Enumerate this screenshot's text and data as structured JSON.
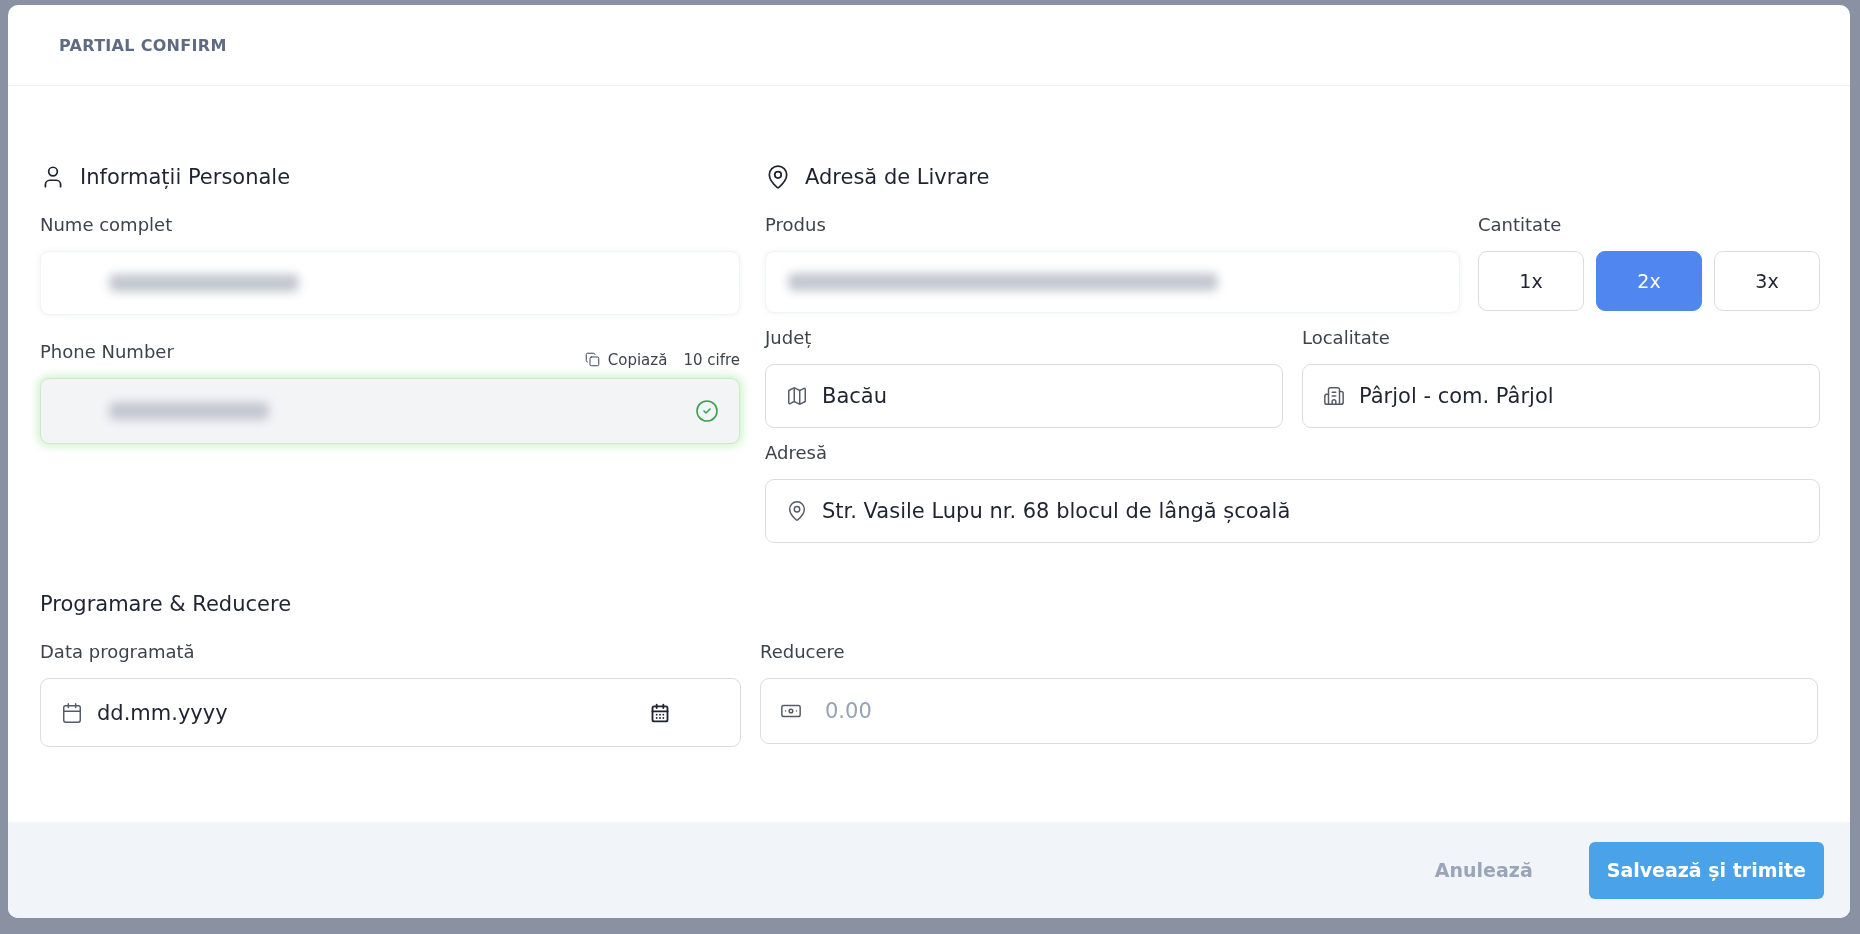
{
  "dialog": {
    "title": "PARTIAL CONFIRM"
  },
  "personal": {
    "heading": "Informații Personale",
    "name_field": {
      "label": "Nume complet",
      "redacted": true
    },
    "phone_field": {
      "label": "Phone Number",
      "copy": "Copiază",
      "digits": "10 cifre",
      "redacted": true,
      "valid": true
    }
  },
  "delivery": {
    "heading": "Adresă de Livrare",
    "product_field": {
      "label": "Produs",
      "redacted": true
    },
    "quantity": {
      "label": "Cantitate",
      "options": [
        {
          "label": "1x",
          "selected": false
        },
        {
          "label": "2x",
          "selected": true
        },
        {
          "label": "3x",
          "selected": false
        }
      ]
    },
    "county": {
      "label": "Județ",
      "value": "Bacău"
    },
    "locality": {
      "label": "Localitate",
      "value": "Pârjol - com. Pârjol"
    },
    "address": {
      "label": "Adresă",
      "value": "Str. Vasile Lupu nr. 68 blocul de lângă școală"
    }
  },
  "schedule": {
    "heading": "Programare & Reducere",
    "date": {
      "label": "Data programată",
      "value": "dd.mm.yyyy"
    },
    "discount": {
      "label": "Reducere",
      "placeholder": "0.00"
    }
  },
  "footer": {
    "buttons": [
      {
        "label": "Anulează",
        "kind": "ghost"
      },
      {
        "label": "Salvează și trimite",
        "kind": "primary"
      }
    ]
  }
}
